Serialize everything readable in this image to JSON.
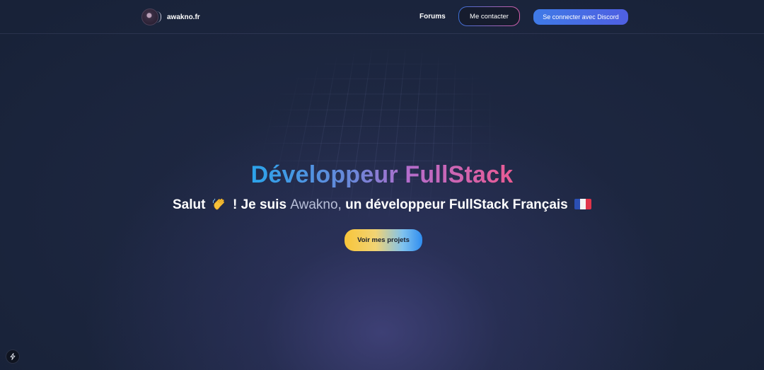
{
  "navbar": {
    "brand_name": "awakno.fr",
    "forums_label": "Forums",
    "contact_label": "Me contacter",
    "discord_label": "Se connecter avec Discord"
  },
  "hero": {
    "title": "Développeur FullStack",
    "subtitle_prefix": "Salut",
    "subtitle_middle": "! Je suis",
    "subtitle_name": "Awakno,",
    "subtitle_suffix": "un développeur FullStack Français",
    "cta_label": "Voir mes projets"
  },
  "icons": {
    "wave": "waving-hand-icon",
    "flag": "france-flag-icon",
    "corner": "lightning-icon"
  },
  "colors": {
    "background": "#182238",
    "title_gradient_start": "#2ba3ea",
    "title_gradient_end": "#ea5b93",
    "discord_button": "#4f5fe2",
    "cta_gradient_start": "#f8c53a",
    "cta_gradient_end": "#2f8df0"
  }
}
